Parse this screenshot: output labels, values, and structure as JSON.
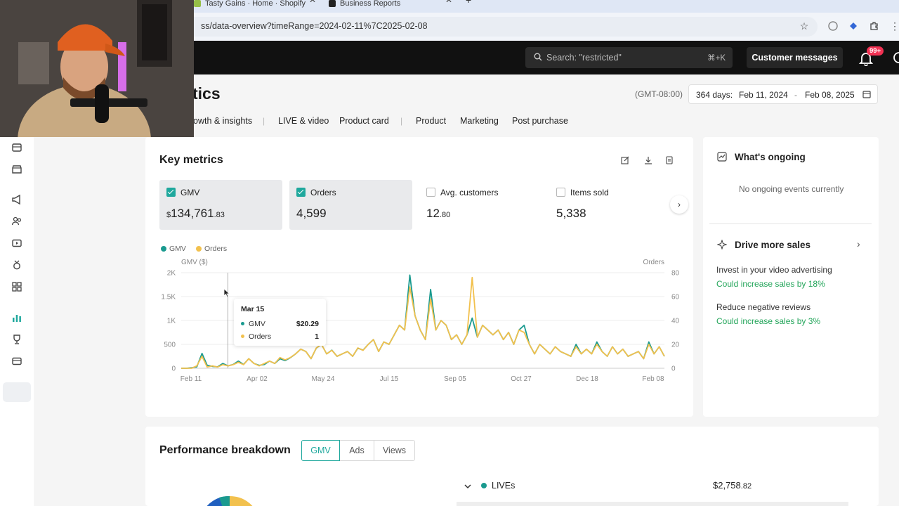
{
  "browser": {
    "tabs": [
      {
        "label": "Tasty Gains · Home · Shopify"
      },
      {
        "label": "Business Reports"
      }
    ],
    "url": "ss/data-overview?timeRange=2024-02-11%7C2025-02-08"
  },
  "header": {
    "search_placeholder": "Search: \"restricted\"",
    "search_shortcut": "⌘+K",
    "customer_messages": "Customer messages",
    "notif_badge": "99+"
  },
  "page": {
    "title": "tics",
    "timezone": "(GMT-08:00)",
    "date_range": {
      "days": "364 days:",
      "start": "Feb 11, 2024",
      "sep": "-",
      "end": "Feb 08, 2025"
    }
  },
  "nav_tabs": [
    "owth & insights",
    "LIVE & video",
    "Product card",
    "Product",
    "Marketing",
    "Post purchase"
  ],
  "key_metrics": {
    "title": "Key metrics",
    "metrics": [
      {
        "label": "GMV",
        "prefix": "$",
        "value": "134,761",
        "decimal": ".83",
        "checked": true
      },
      {
        "label": "Orders",
        "prefix": "",
        "value": "4,599",
        "decimal": "",
        "checked": true
      },
      {
        "label": "Avg. customers",
        "prefix": "",
        "value": "12",
        "decimal": ".80",
        "checked": false
      },
      {
        "label": "Items sold",
        "prefix": "",
        "value": "5,338",
        "decimal": "",
        "checked": false
      }
    ]
  },
  "chart_data": {
    "type": "line",
    "legend": [
      "GMV",
      "Orders"
    ],
    "y_left_label": "GMV ($)",
    "y_right_label": "Orders",
    "y_left_ticks": [
      "2K",
      "1.5K",
      "1K",
      "500",
      "0"
    ],
    "y_right_ticks": [
      "80",
      "60",
      "40",
      "20",
      "0"
    ],
    "ylim_left": [
      0,
      2000
    ],
    "ylim_right": [
      0,
      80
    ],
    "x_ticks": [
      "Feb 11",
      "Apr 02",
      "May 24",
      "Jul 15",
      "Sep 05",
      "Oct 27",
      "Dec 18",
      "Feb 08"
    ],
    "series": [
      {
        "name": "GMV",
        "color": "#1a9a8f",
        "values": [
          0,
          0,
          10,
          30,
          310,
          60,
          40,
          30,
          100,
          50,
          80,
          150,
          80,
          200,
          100,
          60,
          80,
          150,
          100,
          200,
          160,
          220,
          300,
          400,
          350,
          200,
          420,
          500,
          300,
          380,
          250,
          300,
          350,
          250,
          420,
          380,
          500,
          600,
          350,
          550,
          500,
          700,
          900,
          800,
          1950,
          1100,
          800,
          600,
          1650,
          800,
          1000,
          900,
          600,
          700,
          500,
          700,
          1050,
          650,
          900,
          800,
          700,
          800,
          600,
          750,
          500,
          800,
          900,
          500,
          300,
          500,
          400,
          300,
          450,
          350,
          300,
          250,
          500,
          300,
          400,
          300,
          550,
          350,
          250,
          450,
          300,
          400,
          250,
          300,
          350,
          200,
          550,
          300,
          450,
          250
        ]
      },
      {
        "name": "Orders",
        "color": "#f2c14e",
        "values": [
          0,
          0,
          0,
          2,
          10,
          1,
          2,
          1,
          3,
          2,
          3,
          5,
          3,
          8,
          4,
          2,
          4,
          6,
          4,
          9,
          7,
          9,
          12,
          16,
          14,
          8,
          17,
          20,
          12,
          15,
          10,
          12,
          14,
          10,
          17,
          15,
          20,
          24,
          14,
          22,
          20,
          28,
          36,
          32,
          68,
          44,
          32,
          24,
          58,
          32,
          40,
          36,
          24,
          28,
          20,
          28,
          76,
          26,
          36,
          32,
          28,
          32,
          24,
          30,
          20,
          32,
          30,
          20,
          12,
          20,
          16,
          12,
          18,
          14,
          12,
          10,
          18,
          12,
          16,
          12,
          20,
          14,
          10,
          18,
          12,
          16,
          10,
          12,
          14,
          8,
          20,
          12,
          18,
          10
        ]
      }
    ]
  },
  "tooltip": {
    "date": "Mar 15",
    "gmv_label": "GMV",
    "gmv_value": "$20.29",
    "orders_label": "Orders",
    "orders_value": "1"
  },
  "ongoing": {
    "title": "What's ongoing",
    "empty": "No ongoing events currently"
  },
  "drive_sales": {
    "title": "Drive more sales",
    "items": [
      {
        "text": "Invest in your video advertising",
        "impact": "Could increase sales by 18%"
      },
      {
        "text": "Reduce negative reviews",
        "impact": "Could increase sales by 3%"
      }
    ]
  },
  "performance": {
    "title": "Performance breakdown",
    "tabs": [
      "GMV",
      "Ads",
      "Views"
    ],
    "rows": [
      {
        "label": "LIVEs",
        "prefix": "$",
        "value": "2,758",
        "decimal": ".82"
      }
    ]
  },
  "colors": {
    "gmv": "#1a9a8f",
    "orders": "#f2c14e",
    "accent": "#1fa89d",
    "green": "#23a55a"
  }
}
